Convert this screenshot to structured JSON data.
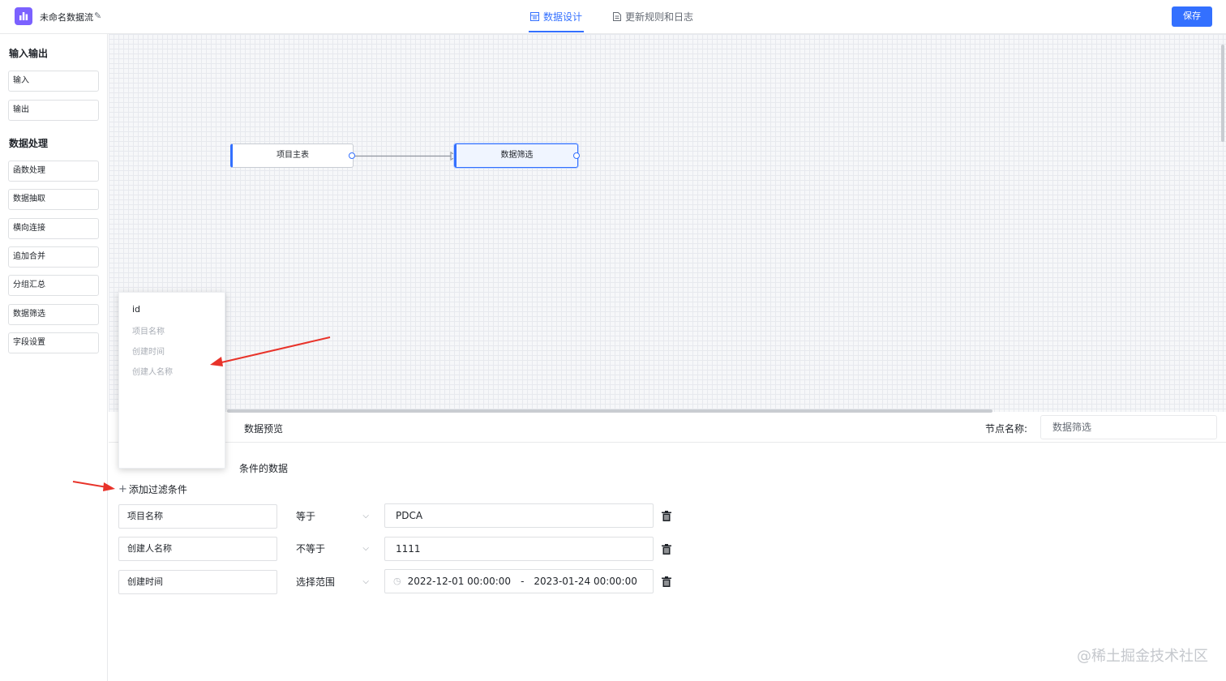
{
  "header": {
    "app_title": "未命名数据流",
    "tabs": [
      {
        "label": "数据设计",
        "active": true
      },
      {
        "label": "更新规则和日志",
        "active": false
      }
    ],
    "save_label": "保存"
  },
  "sidebar": {
    "group_io": "输入输出",
    "io_items": [
      "输入",
      "输出"
    ],
    "group_processing": "数据处理",
    "processing_items": [
      "函数处理",
      "数据抽取",
      "横向连接",
      "追加合并",
      "分组汇总",
      "数据筛选",
      "字段设置"
    ]
  },
  "canvas": {
    "nodes": [
      {
        "label": "项目主表"
      },
      {
        "label": "数据筛选",
        "selected": true
      }
    ]
  },
  "panel": {
    "tab_preview": "数据预览",
    "node_name_label": "节点名称:",
    "node_name_value": "数据筛选",
    "description_tail": "条件的数据",
    "add_filter_label": "添加过滤条件",
    "filters": [
      {
        "field": "项目名称",
        "operator": "等于",
        "value": "PDCA"
      },
      {
        "field": "创建人名称",
        "operator": "不等于",
        "value": "1111"
      },
      {
        "field": "创建时间",
        "operator": "选择范围",
        "start": "2022-12-01 00:00:00",
        "separator": "-",
        "end": "2023-01-24 00:00:00"
      }
    ]
  },
  "dropdown": {
    "options": [
      "id",
      "项目名称",
      "创建时间",
      "创建人名称"
    ]
  },
  "watermark": "@稀土掘金技术社区",
  "colors": {
    "accent": "#3370ff",
    "logo": "#7b61ff",
    "annotation_arrow": "#e8332a"
  }
}
